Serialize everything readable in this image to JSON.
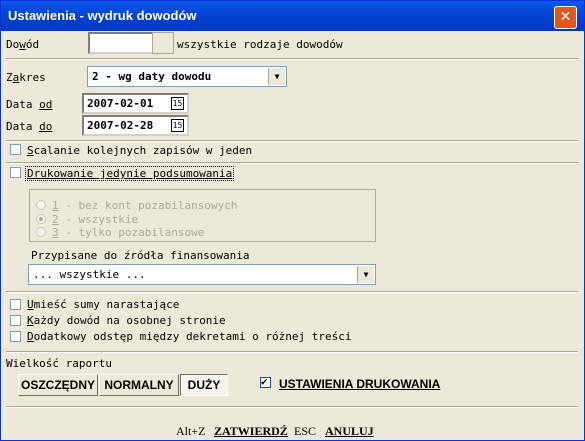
{
  "window": {
    "title": "Ustawienia - wydruk dowodów",
    "close_glyph": "✕"
  },
  "dowod": {
    "label_pre": "Do",
    "label_u": "w",
    "label_post": "ód",
    "value": "",
    "hint": "wszystkie rodzaje dowodów"
  },
  "zakres": {
    "label_pre": "Z",
    "label_u": "a",
    "label_post": "kres",
    "selected": "2 - wg daty dowodu"
  },
  "dates": {
    "od": {
      "label_pre": "Data ",
      "label_u": "od",
      "value": "2007-02-01"
    },
    "do": {
      "label_pre": "Data ",
      "label_u": "do",
      "value": "2007-02-28"
    },
    "cal_glyph": "15"
  },
  "options": {
    "scalanie": {
      "u": "S",
      "rest": "calanie kolejnych zapisów w jeden",
      "checked": false
    },
    "podsumowanie": {
      "label": "Drukowanie jedynie podsumowania",
      "checked": false
    }
  },
  "pozabilansowe": {
    "r1": {
      "num": "1",
      "rest": " - bez kont pozabilansowych",
      "selected": false
    },
    "r2": {
      "num": "2",
      "rest": " - wszystkie",
      "selected": true
    },
    "r3": {
      "num": "3",
      "rest": " - tylko pozabilansowe",
      "selected": false
    }
  },
  "zrodla": {
    "label": "Przypisane do źródła finansowania",
    "selected": "... wszystkie ..."
  },
  "extras": {
    "sumy": {
      "u": "U",
      "rest": "mieść sumy narastające",
      "checked": false
    },
    "osobna": {
      "u": "K",
      "rest": "ażdy dowód na osobnej stronie",
      "checked": false
    },
    "odstep": {
      "u": "D",
      "rest": "odatkowy odstęp między dekretami o różnej treści",
      "checked": false
    }
  },
  "raport": {
    "label": "Wielkość raportu",
    "sizes": [
      "OSZCZĘDNY",
      "NORMALNY",
      "DUŻY"
    ],
    "active": "DUŻY",
    "print_settings": {
      "label": "USTAWIENIA DRUKOWANIA",
      "checked": true
    }
  },
  "footer": {
    "confirm_key": "Alt+Z",
    "confirm_label": "ZATWIERDŹ",
    "cancel_key": "ESC",
    "cancel_label": "ANULUJ"
  }
}
